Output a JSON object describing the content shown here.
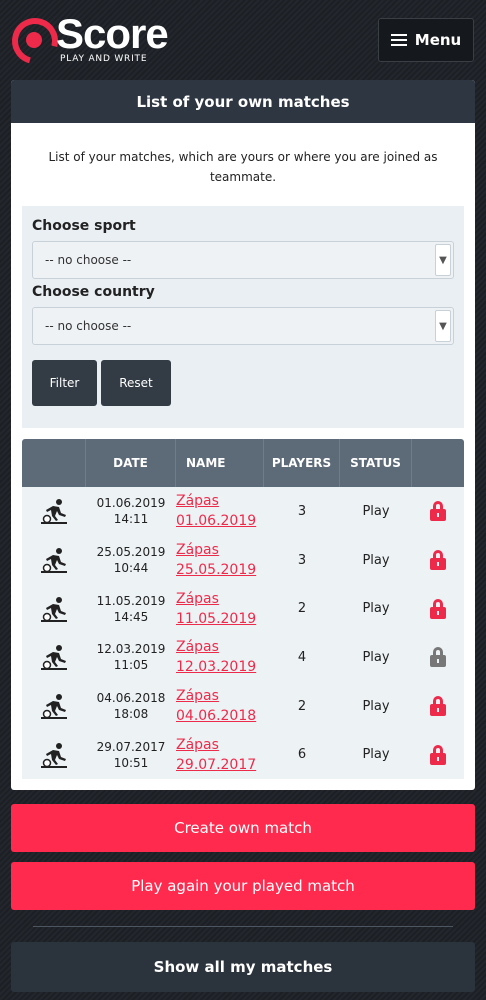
{
  "header": {
    "logo_word": "Score",
    "logo_tagline": "PLAY AND WRITE",
    "menu_label": "Menu"
  },
  "card": {
    "title": "List of your own matches",
    "intro": "List of your matches, which are yours or where you are joined as teammate."
  },
  "filter": {
    "sport_label": "Choose sport",
    "sport_value": "-- no choose --",
    "country_label": "Choose country",
    "country_value": "-- no choose --",
    "filter_button": "Filter",
    "reset_button": "Reset"
  },
  "table": {
    "headers": [
      "",
      "DATE",
      "NAME",
      "PLAYERS",
      "STATUS",
      ""
    ],
    "rows": [
      {
        "date": "01.06.2019",
        "time": "14:11",
        "name1": "Zápas",
        "name2": "01.06.2019",
        "players": "3",
        "status": "Play",
        "lock": "red"
      },
      {
        "date": "25.05.2019",
        "time": "10:44",
        "name1": "Zápas",
        "name2": "25.05.2019",
        "players": "3",
        "status": "Play",
        "lock": "red"
      },
      {
        "date": "11.05.2019",
        "time": "14:45",
        "name1": "Zápas",
        "name2": "11.05.2019",
        "players": "2",
        "status": "Play",
        "lock": "red"
      },
      {
        "date": "12.03.2019",
        "time": "11:05",
        "name1": "Zápas",
        "name2": "12.03.2019",
        "players": "4",
        "status": "Play",
        "lock": "gray"
      },
      {
        "date": "04.06.2018",
        "time": "18:08",
        "name1": "Zápas",
        "name2": "04.06.2018",
        "players": "2",
        "status": "Play",
        "lock": "red"
      },
      {
        "date": "29.07.2017",
        "time": "10:51",
        "name1": "Zápas",
        "name2": "29.07.2017",
        "players": "6",
        "status": "Play",
        "lock": "red"
      }
    ]
  },
  "actions": {
    "create": "Create own match",
    "play_again": "Play again your played match",
    "show_all": "Show all my matches"
  },
  "colors": {
    "accent": "#ff2a4e",
    "lock_red": "#ee2a4b",
    "lock_gray": "#777777"
  }
}
